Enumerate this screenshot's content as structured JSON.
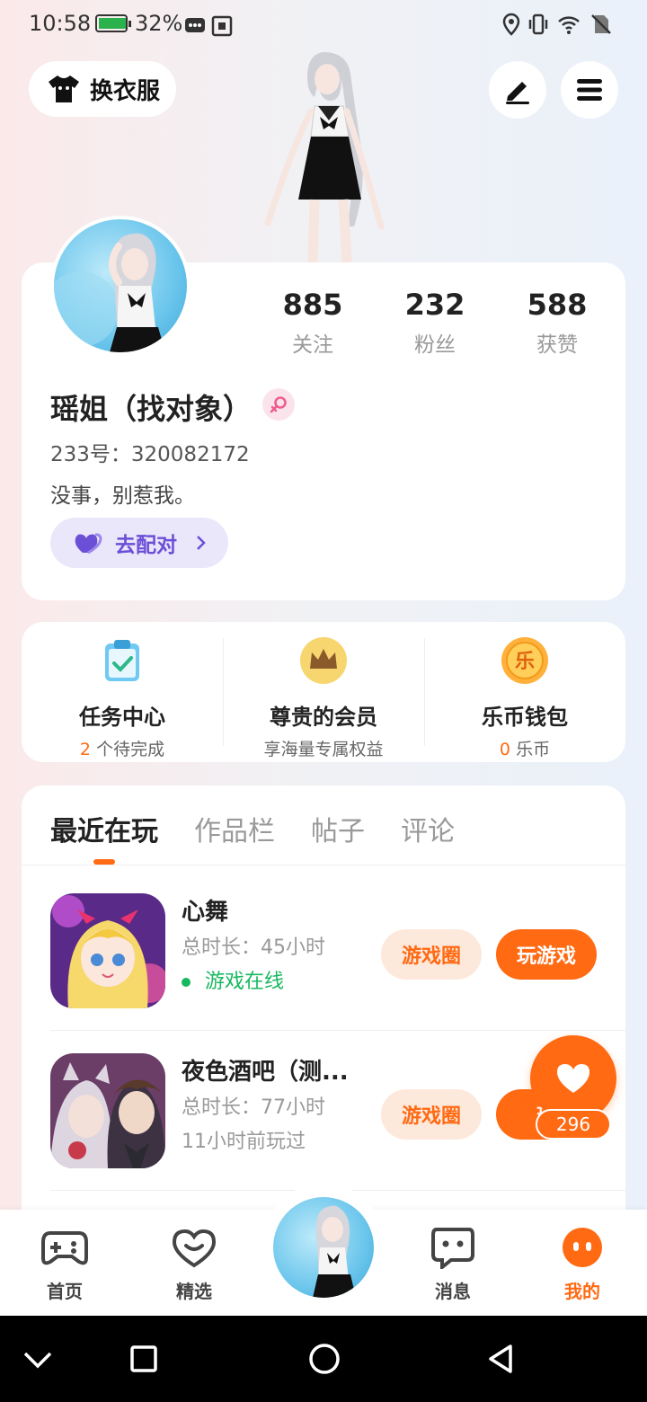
{
  "status_bar": {
    "time": "10:58",
    "battery_pct": "32%",
    "battery_level": 0.32
  },
  "header": {
    "outfit_label": "换衣服",
    "edit_icon": "pencil-icon",
    "menu_icon": "hamburger-menu-icon"
  },
  "profile": {
    "stats": [
      {
        "value": "885",
        "label": "关注"
      },
      {
        "value": "232",
        "label": "粉丝"
      },
      {
        "value": "588",
        "label": "获赞"
      }
    ],
    "name": "瑶姐（找对象）",
    "gender_icon": "female-icon",
    "uid": "233号：320082172",
    "bio": "没事，别惹我。",
    "match_label": "去配对"
  },
  "services": [
    {
      "icon": "clipboard-check-icon",
      "title": "任务中心",
      "count": "2",
      "sub": "个待完成"
    },
    {
      "icon": "crown-icon",
      "title": "尊贵的会员",
      "count": "",
      "sub": "享海量专属权益"
    },
    {
      "icon": "coin-le-icon",
      "title": "乐币钱包",
      "count": "0",
      "sub": "乐币",
      "coin_glyph": "乐"
    }
  ],
  "tabs": [
    "最近在玩",
    "作品栏",
    "帖子",
    "评论"
  ],
  "games": [
    {
      "name": "心舞",
      "duration": "总时长：45小时",
      "status": "游戏在线",
      "online": true,
      "circle_label": "游戏圈",
      "play_label": "玩游戏"
    },
    {
      "name": "夜色酒吧（测...",
      "duration": "总时长：77小时",
      "status": "11小时前玩过",
      "online": false,
      "circle_label": "游戏圈",
      "play_label": "玩"
    }
  ],
  "like_fab": {
    "count": "296"
  },
  "bottom_nav": [
    {
      "label": "首页",
      "icon": "gamepad-icon"
    },
    {
      "label": "精选",
      "icon": "heart-chat-icon"
    },
    {
      "label": "消息",
      "icon": "message-icon"
    },
    {
      "label": "我的",
      "icon": "profile-face-icon",
      "active": true
    }
  ],
  "colors": {
    "accent": "#ff6a13",
    "match": "#6b4fd6",
    "online": "#18b85f"
  }
}
